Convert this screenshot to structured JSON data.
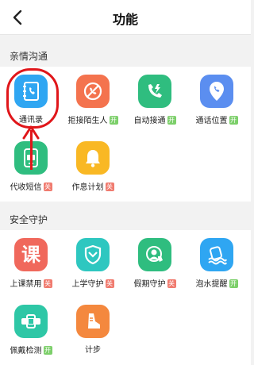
{
  "header": {
    "title": "功能"
  },
  "sections": [
    {
      "title": "亲情沟通",
      "items": [
        {
          "label": "通讯录",
          "badge": "",
          "color": "#2fa6f2",
          "icon": "contacts-book-icon"
        },
        {
          "label": "拒接陌生人",
          "badge": "开",
          "color": "#f4734e",
          "icon": "call-block-icon"
        },
        {
          "label": "自动接通",
          "badge": "开",
          "color": "#2fbd7f",
          "icon": "auto-answer-icon"
        },
        {
          "label": "通话位置",
          "badge": "开",
          "color": "#5b8ef0",
          "icon": "call-location-icon"
        },
        {
          "label": "代收短信",
          "badge": "关",
          "color": "#2fbd7f",
          "icon": "sms-icon"
        },
        {
          "label": "作息计划",
          "badge": "关",
          "color": "#f9b824",
          "icon": "bell-icon"
        }
      ]
    },
    {
      "title": "安全守护",
      "items": [
        {
          "label": "上课禁用",
          "badge": "关",
          "color": "#f0685c",
          "icon": "class-mode-icon",
          "glyph": "课"
        },
        {
          "label": "上学守护",
          "badge": "关",
          "color": "#2ec7c0",
          "icon": "shield-icon"
        },
        {
          "label": "假期守护",
          "badge": "关",
          "color": "#2fbd7f",
          "icon": "holiday-guard-icon"
        },
        {
          "label": "泡水提醒",
          "badge": "开",
          "color": "#2fa6f2",
          "icon": "water-alert-icon"
        },
        {
          "label": "佩戴检测",
          "badge": "开",
          "color": "#2ec7a6",
          "icon": "wear-detect-icon"
        },
        {
          "label": "计步",
          "badge": "",
          "color": "#f4883e",
          "icon": "step-counter-icon"
        }
      ]
    }
  ],
  "badge_colors": {
    "on": "#7ccf6a",
    "off": "#f07b6f"
  },
  "annotation_color": "#e0161a"
}
